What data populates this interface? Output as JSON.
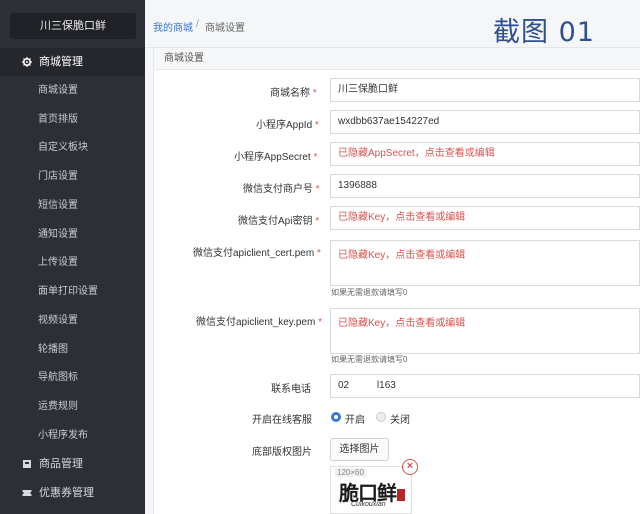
{
  "sidebar": {
    "shop_name": "川三保脆口鲜",
    "groups": [
      {
        "label": "商城管理",
        "icon": "gear-icon"
      },
      {
        "label": "商品管理",
        "icon": "box-icon"
      },
      {
        "label": "优惠券管理",
        "icon": "ticket-icon"
      }
    ],
    "items": [
      "商城设置",
      "首页排版",
      "自定义板块",
      "门店设置",
      "短信设置",
      "通知设置",
      "上传设置",
      "面单打印设置",
      "视频设置",
      "轮播图",
      "导航图标",
      "运费规则",
      "小程序发布"
    ]
  },
  "header": {
    "breadcrumb_home": "我的商城",
    "breadcrumb_sep": "/",
    "breadcrumb_current": "商城设置",
    "stamp": "截图 01"
  },
  "panel": {
    "title": "商城设置"
  },
  "form": {
    "name_label": "商城名称",
    "name_value": "川三保脆口鲜",
    "appid_label": "小程序AppId",
    "appid_value": "wxdbb637ae154227ed",
    "appsecret_label": "小程序AppSecret",
    "appsecret_value": "已隐藏AppSecret，点击查看或编辑",
    "mchid_label": "微信支付商户号",
    "mchid_value": "1396888",
    "apikey_label": "微信支付Api密钥",
    "apikey_value": "已隐藏Key，点击查看或编辑",
    "cert_label": "微信支付apiclient_cert.pem",
    "cert_value": "已隐藏Key，点击查看或编辑",
    "cert_hint": "如果无需退款请填写0",
    "key_label": "微信支付apiclient_key.pem",
    "key_value": "已隐藏Key，点击查看或编辑",
    "key_hint": "如果无需退款请填写0",
    "phone_label": "联系电话",
    "phone_value": "02          l163",
    "service_label": "开启在线客服",
    "service_on": "开启",
    "service_off": "关闭",
    "copyright_label": "底部版权图片",
    "choose_image": "选择图片",
    "image_size": "120×60",
    "logo_text": "脆口鲜",
    "logo_sub": "Cuikouxian",
    "required_mark": "*"
  },
  "colors": {
    "sidebar_bg": "#2d2f36",
    "accent": "#3a7bd5",
    "required": "#e05050",
    "hidden_text": "#d9534f"
  }
}
